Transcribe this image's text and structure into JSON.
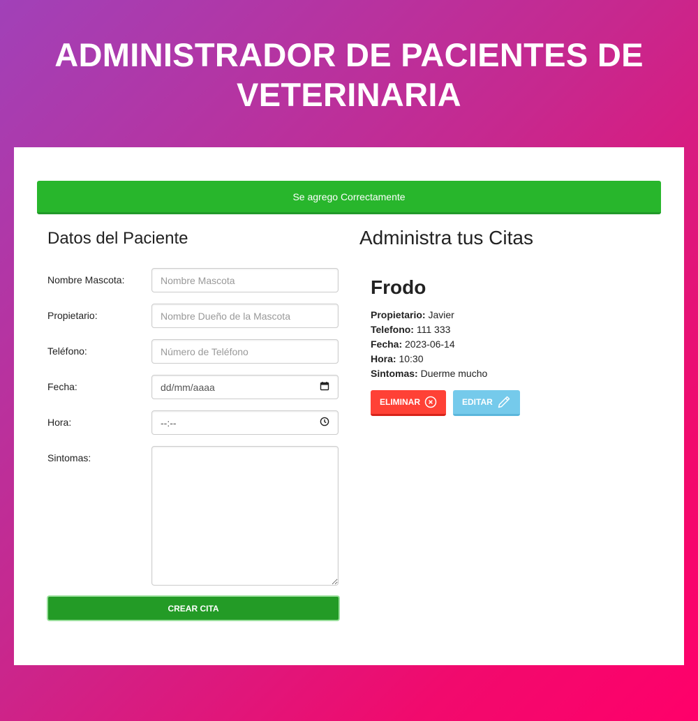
{
  "header": {
    "title_line1": "ADMINISTRADOR DE PACIENTES DE",
    "title_line2": "VETERINARIA"
  },
  "alert": {
    "message": "Se agrego Correctamente",
    "color": "#28b62c"
  },
  "form": {
    "title": "Datos del Paciente",
    "fields": [
      {
        "label": "Nombre Mascota:",
        "placeholder": "Nombre Mascota",
        "value": ""
      },
      {
        "label": "Propietario:",
        "placeholder": "Nombre Dueño de la Mascota",
        "value": ""
      },
      {
        "label": "Teléfono:",
        "placeholder": "Número de Teléfono",
        "value": ""
      },
      {
        "label": "Fecha:",
        "placeholder": "dd/mm/aaaa",
        "value": ""
      },
      {
        "label": "Hora:",
        "placeholder": "--:--",
        "value": ""
      },
      {
        "label": "Sintomas:",
        "placeholder": "",
        "value": ""
      }
    ],
    "submit_label": "CREAR CITA"
  },
  "citas": {
    "title": "Administra tus Citas",
    "items": [
      {
        "mascota": "Frodo",
        "propietario_label": "Propietario:",
        "propietario": "Javier",
        "telefono_label": "Telefono:",
        "telefono": "111 333",
        "fecha_label": "Fecha:",
        "fecha": "2023-06-14",
        "hora_label": "Hora:",
        "hora": "10:30",
        "sintomas_label": "Sintomas:",
        "sintomas": "Duerme mucho",
        "delete_label": "ELIMINAR",
        "edit_label": "EDITAR"
      }
    ]
  },
  "colors": {
    "danger": "#ff4136",
    "info": "#75caeb",
    "success": "#239b26"
  },
  "icons": {
    "delete": "x-circle-icon",
    "edit": "pencil-icon",
    "date": "calendar-icon",
    "time": "clock-icon"
  }
}
